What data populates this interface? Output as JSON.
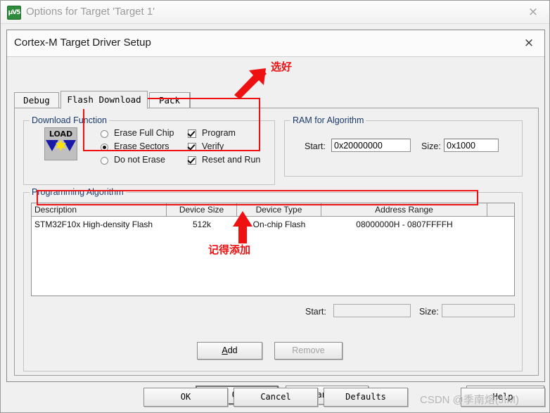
{
  "outer_window": {
    "title": "Options for Target 'Target 1'",
    "app_icon_text": "µV5",
    "close_label": "×"
  },
  "dialog": {
    "title": "Cortex-M Target Driver Setup",
    "close_label": "×"
  },
  "tabs": [
    {
      "label": "Debug",
      "active": false
    },
    {
      "label": "Flash Download",
      "active": true
    },
    {
      "label": "Pack",
      "active": false
    }
  ],
  "download_function": {
    "group_title": "Download Function",
    "icon_text": "LOAD",
    "erase_options": [
      {
        "label": "Erase Full Chip",
        "selected": false
      },
      {
        "label": "Erase Sectors",
        "selected": true
      },
      {
        "label": "Do not Erase",
        "selected": false
      }
    ],
    "checkboxes": [
      {
        "label": "Program",
        "checked": true
      },
      {
        "label": "Verify",
        "checked": true
      },
      {
        "label": "Reset and Run",
        "checked": true
      }
    ]
  },
  "ram_for_algorithm": {
    "group_title": "RAM for Algorithm",
    "start_label": "Start:",
    "start_value": "0x20000000",
    "size_label": "Size:",
    "size_value": "0x1000"
  },
  "programming_algorithm": {
    "group_title": "Programming Algorithm",
    "columns": [
      "Description",
      "Device Size",
      "Device Type",
      "Address Range",
      ""
    ],
    "rows": [
      {
        "description": "STM32F10x High-density Flash",
        "device_size": "512k",
        "device_type": "On-chip Flash",
        "address_range": "08000000H - 0807FFFFH"
      }
    ],
    "start_label": "Start:",
    "start_value": "",
    "size_label": "Size:",
    "size_value": "",
    "add_button": "Add",
    "add_mnemonic": "A",
    "add_rest": "dd",
    "remove_button": "Remove"
  },
  "dialog_buttons": {
    "ok": "OK",
    "cancel": "Cancel",
    "help": "Help"
  },
  "outer_buttons": {
    "ok": "OK",
    "cancel": "Cancel",
    "defaults": "Defaults",
    "help": "Help"
  },
  "annotations": {
    "top": "选好",
    "bottom": "记得添加",
    "highlight_color": "#ee1111"
  },
  "watermark": "CSDN @季南熔(JIM)"
}
